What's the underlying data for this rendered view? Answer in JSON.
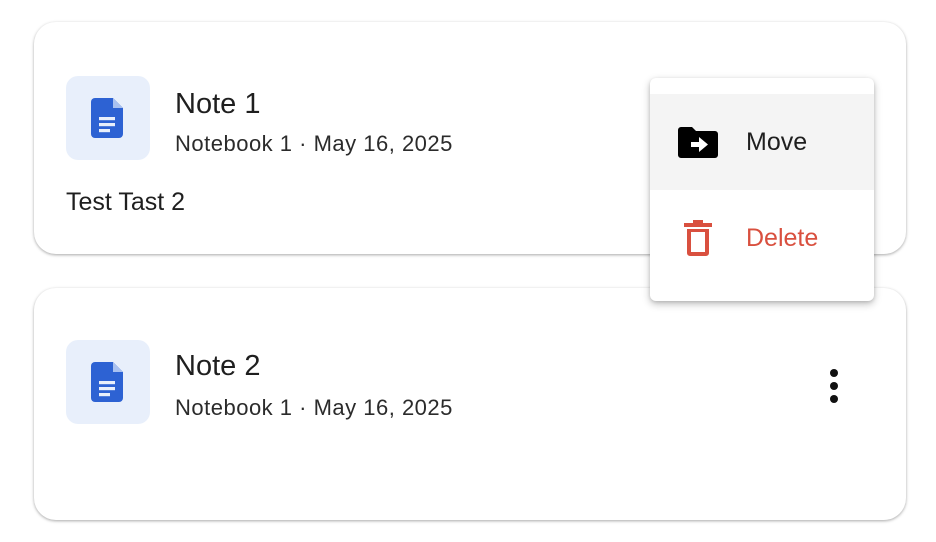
{
  "notes": [
    {
      "title": "Note 1",
      "meta": "Notebook 1 · May 16, 2025",
      "body": "Test Tast 2",
      "icon": "document-icon"
    },
    {
      "title": "Note 2",
      "meta": "Notebook 1 · May 16, 2025",
      "body": "",
      "icon": "document-icon",
      "more_icon": "more-vert-icon"
    }
  ],
  "context_menu": {
    "items": [
      {
        "label": "Move",
        "icon": "folder-move-icon",
        "color": "#1f1f1f",
        "state": "hovered"
      },
      {
        "label": "Delete",
        "icon": "trash-icon",
        "color": "#d9503f"
      }
    ]
  },
  "colors": {
    "doc_icon": "#2d62d3",
    "doc_tile_bg": "#e8effb",
    "delete_red": "#d9503f",
    "hover_bg": "#f4f4f4"
  }
}
